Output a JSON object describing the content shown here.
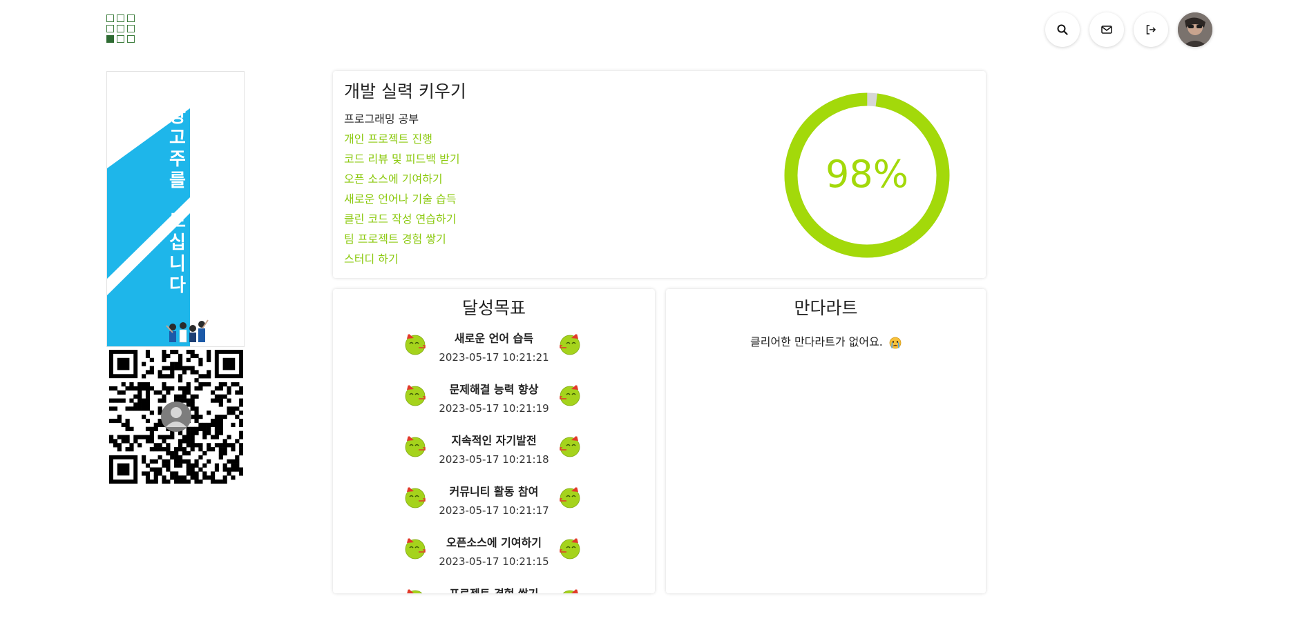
{
  "header": {
    "icons": [
      "grid-logo-icon",
      "search-icon",
      "mail-icon",
      "logout-icon"
    ],
    "avatar_alt": "user-avatar"
  },
  "ad": {
    "text_line1": "광고주를",
    "text_line2": "모십니다",
    "accent_color": "#1eb6ea"
  },
  "main": {
    "title": "개발 실력 키우기",
    "tasks": [
      "프로그래밍 공부",
      "개인 프로젝트 진행",
      "코드 리뷰 및 피드백 받기",
      "오픈 소스에 기여하기",
      "새로운 언어나 기술 습득",
      "클린 코드 작성 연습하기",
      "팀 프로젝트 경험 쌓기",
      "스터디 하기"
    ],
    "progress_percent": 98,
    "progress_label": "98%",
    "progress_color": "#a3d90a",
    "track_color": "#d6d6d6"
  },
  "goals": {
    "title": "달성목표",
    "items": [
      {
        "name": "새로운 언어 습득",
        "date": "2023-05-17 10:21:21"
      },
      {
        "name": "문제해결 능력 향상",
        "date": "2023-05-17 10:21:19"
      },
      {
        "name": "지속적인 자기발전",
        "date": "2023-05-17 10:21:18"
      },
      {
        "name": "커뮤니티 활동 참여",
        "date": "2023-05-17 10:21:17"
      },
      {
        "name": "오픈소스에 기여하기",
        "date": "2023-05-17 10:21:15"
      },
      {
        "name": "프로젝트 경험 쌓기",
        "date": ""
      }
    ]
  },
  "mandal": {
    "title": "만다라트",
    "empty_message": "클리어한 만다라트가 없어요."
  }
}
